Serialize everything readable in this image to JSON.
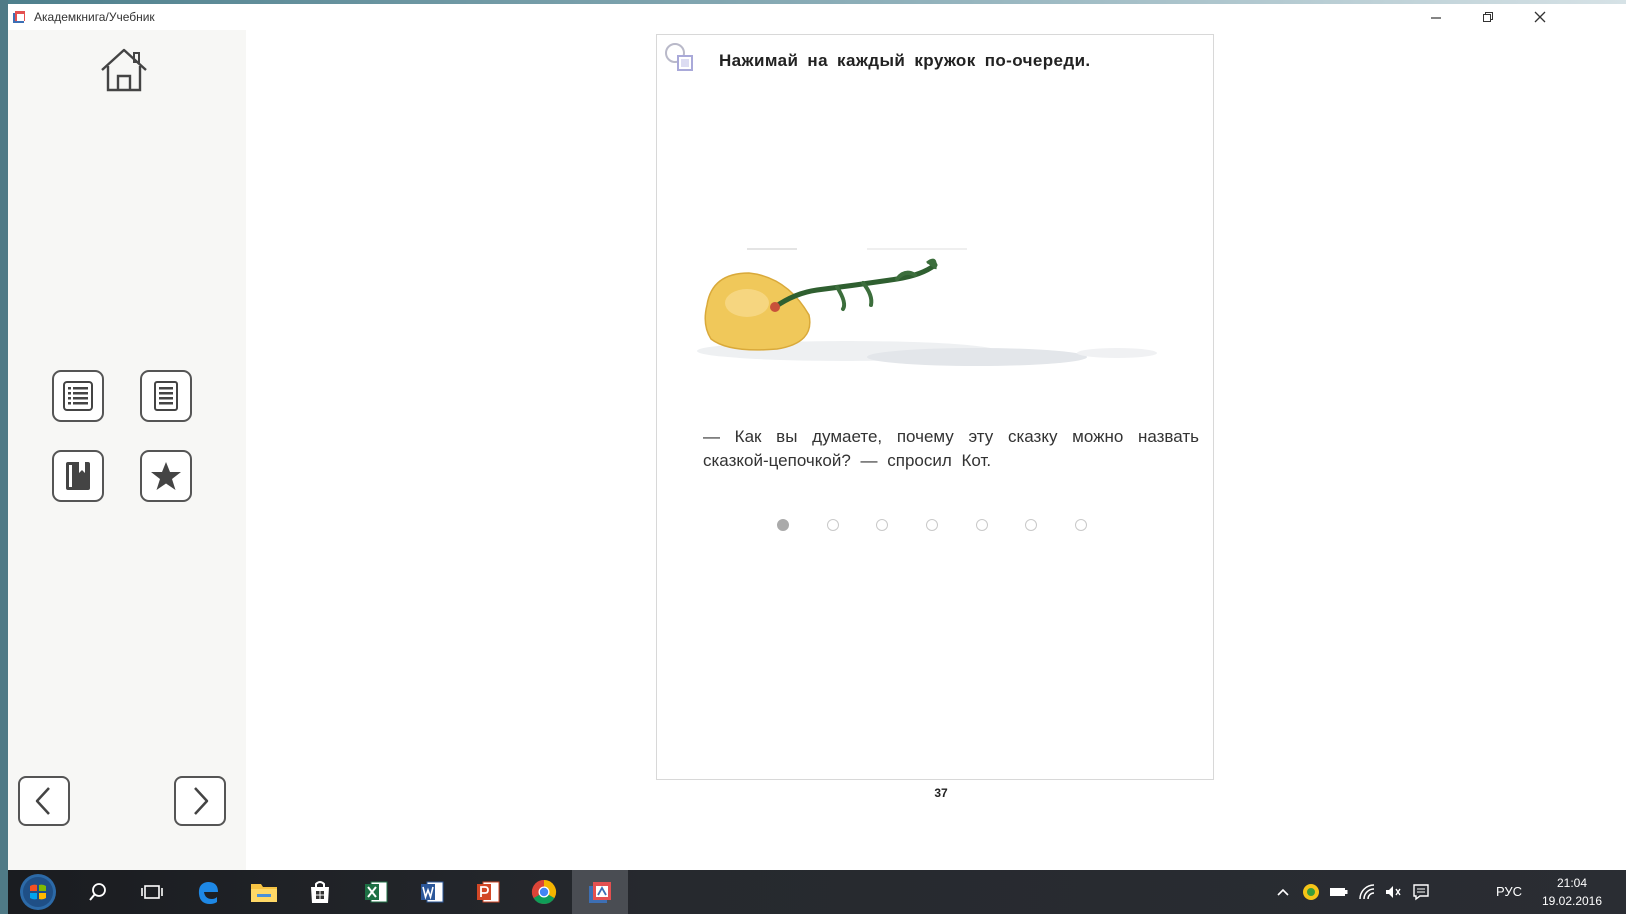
{
  "window": {
    "title": "Академкнига/Учебник",
    "controls": {
      "minimize": "minimize-icon",
      "restore": "restore-icon",
      "close": "close-icon"
    }
  },
  "sidebar": {
    "home": "home-icon",
    "tools": [
      "contents-list-icon",
      "page-list-icon",
      "bookmark-icon",
      "star-icon"
    ],
    "prev": "chevron-left-icon",
    "next": "chevron-right-icon"
  },
  "page": {
    "instruction": "Нажимай на каждый кружок по-очереди.",
    "story": "— Как вы думаете, почему эту сказку можно назвать сказкой-цепочкой? — спросил Кот.",
    "dots_total": 7,
    "dots_active_index": 0,
    "page_number": "37"
  },
  "taskbar": {
    "apps": [
      "start-button-icon",
      "search-icon",
      "task-view-icon",
      "edge-icon",
      "file-explorer-icon",
      "store-icon",
      "excel-icon",
      "word-icon",
      "powerpoint-icon",
      "chrome-icon",
      "akademkniga-app-icon"
    ],
    "active_app": "akademkniga-app-icon",
    "tray": [
      "show-hidden-icons-chevron",
      "app-tray-icon",
      "battery-icon",
      "network-icon",
      "volume-icon",
      "notifications-icon"
    ],
    "language": "РУС",
    "time": "21:04",
    "date": "19.02.2016"
  },
  "colors": {
    "accent": "#4f7a86",
    "taskbar": "#1f2226",
    "sidebar": "#f7f7f5"
  }
}
